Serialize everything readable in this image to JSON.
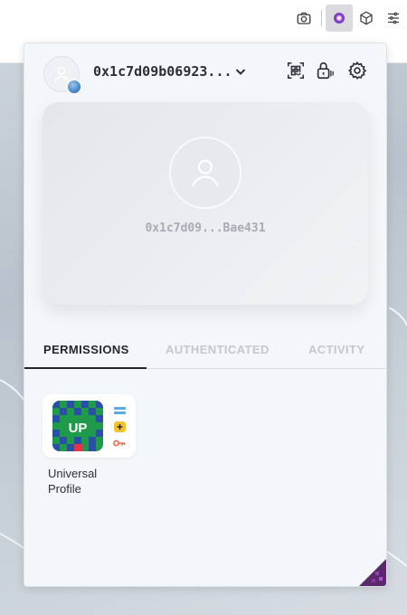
{
  "browser": {
    "toolbar_icons": [
      "camera-icon",
      "extension-up-icon",
      "cube-icon",
      "sliders-icon"
    ]
  },
  "header": {
    "address": "0x1c7d09b06923...",
    "icons": [
      "qr-code-icon",
      "lock-icon",
      "gear-icon"
    ]
  },
  "profile": {
    "address": "0x1c7d09...Bae431"
  },
  "tabs": [
    {
      "label": "PERMISSIONS",
      "active": true
    },
    {
      "label": "AUTHENTICATED",
      "active": false
    },
    {
      "label": "ACTIVITY",
      "active": false
    }
  ],
  "apps": [
    {
      "icon_text": "UP",
      "name": "Universal Profile"
    }
  ],
  "colors": {
    "accent": "#22262c",
    "app_green": "#1f9a4a",
    "app_blue": "#2a4fa6",
    "perm_blue": "#5aa9e6",
    "perm_yellow": "#f2c230",
    "perm_orange": "#e86a4a"
  }
}
